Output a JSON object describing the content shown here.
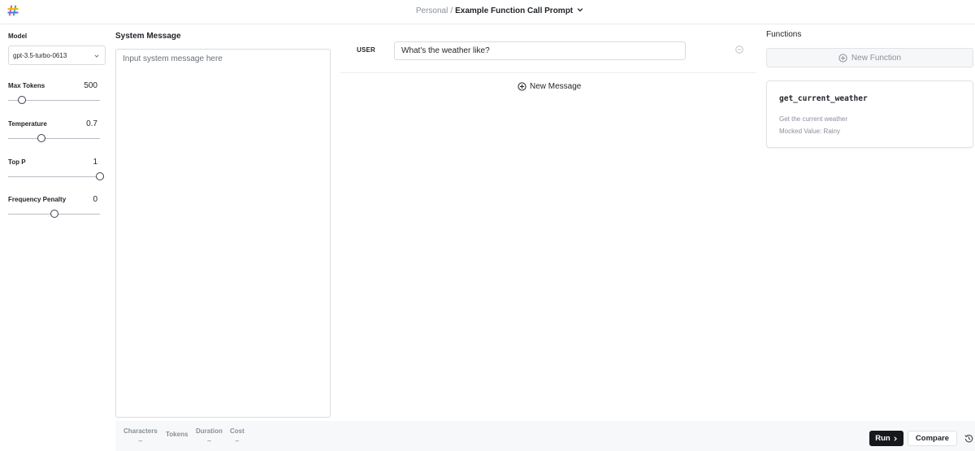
{
  "header": {
    "workspace": "Personal",
    "separator": "/",
    "prompt_name": "Example Function Call Prompt",
    "accent_colors": [
      "#e45b9a",
      "#3bb3a2",
      "#f4b400",
      "#5b6ee1"
    ]
  },
  "params": {
    "model_label": "Model",
    "model_value": "gpt-3.5-turbo-0613",
    "sliders": [
      {
        "label": "Max Tokens",
        "value_text": "500",
        "fraction": 0.15
      },
      {
        "label": "Temperature",
        "value_text": "0.7",
        "fraction": 0.36
      },
      {
        "label": "Top P",
        "value_text": "1",
        "fraction": 1.0
      },
      {
        "label": "Frequency Penalty",
        "value_text": "0",
        "fraction": 0.5
      }
    ]
  },
  "system": {
    "title": "System Message",
    "placeholder": "Input system message here"
  },
  "messages": {
    "role": "USER",
    "content": "What's the weather like?",
    "new_message_label": "New Message"
  },
  "functions": {
    "title": "Functions",
    "new_function_label": "New Function",
    "items": [
      {
        "name": "get_current_weather",
        "description": "Get the current weather",
        "mocked": "Mocked Value: Rainy"
      }
    ]
  },
  "footer": {
    "stats": [
      {
        "label": "Characters",
        "value": "–"
      },
      {
        "label": "Tokens",
        "value": ""
      },
      {
        "label": "Duration",
        "value": "–"
      },
      {
        "label": "Cost",
        "value": "–"
      }
    ],
    "run_label": "Run",
    "compare_label": "Compare"
  }
}
